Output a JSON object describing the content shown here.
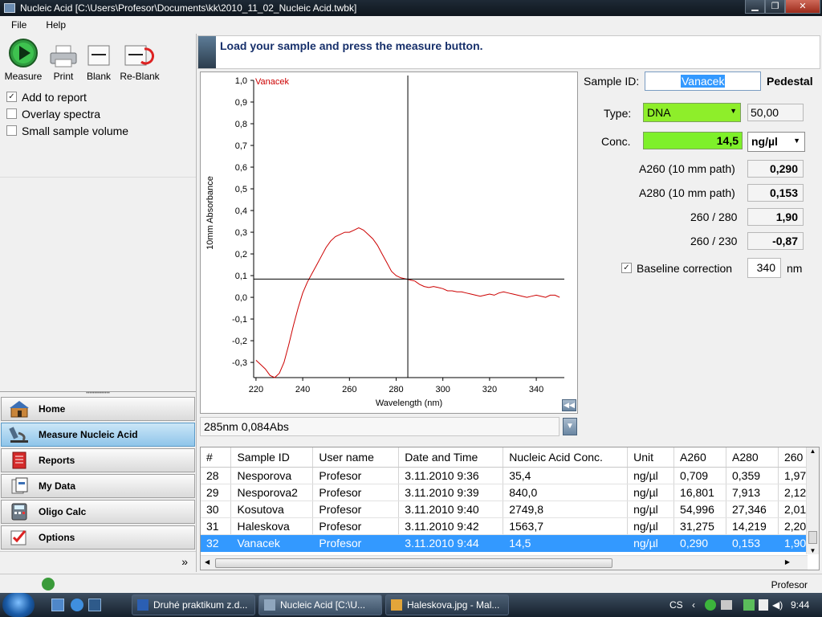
{
  "window": {
    "title": "Nucleic Acid  [C:\\Users\\Profesor\\Documents\\kk\\2010_11_02_Nucleic Acid.twbk]"
  },
  "menu": [
    "File",
    "Help"
  ],
  "toolbar": {
    "measure": "Measure",
    "print": "Print",
    "blank": "Blank",
    "reblank": "Re-Blank"
  },
  "options": {
    "add_to_report": {
      "label": "Add to report",
      "checked": true
    },
    "overlay_spectra": {
      "label": "Overlay spectra",
      "checked": false
    },
    "small_sample": {
      "label": "Small sample volume",
      "checked": false
    }
  },
  "nav": [
    {
      "label": "Home",
      "icon": "home-icon",
      "active": false
    },
    {
      "label": "Measure Nucleic Acid",
      "icon": "microscope-icon",
      "active": true
    },
    {
      "label": "Reports",
      "icon": "reports-icon",
      "active": false
    },
    {
      "label": "My Data",
      "icon": "my-data-icon",
      "active": false
    },
    {
      "label": "Oligo Calc",
      "icon": "calculator-icon",
      "active": false
    },
    {
      "label": "Options",
      "icon": "options-icon",
      "active": false
    }
  ],
  "message": "Load your sample and press the measure button.",
  "chart_data": {
    "type": "line",
    "series": [
      {
        "name": "Vanacek",
        "color": "#cc0000",
        "x": [
          220,
          222,
          224,
          226,
          228,
          230,
          232,
          234,
          236,
          238,
          240,
          242,
          244,
          246,
          248,
          250,
          252,
          254,
          256,
          258,
          260,
          262,
          264,
          266,
          268,
          270,
          272,
          274,
          276,
          278,
          280,
          282,
          284,
          286,
          288,
          290,
          292,
          294,
          296,
          298,
          300,
          302,
          304,
          306,
          308,
          310,
          312,
          314,
          316,
          318,
          320,
          322,
          324,
          326,
          328,
          330,
          332,
          334,
          336,
          338,
          340,
          342,
          344,
          346,
          348,
          350
        ],
        "y": [
          -0.29,
          -0.31,
          -0.33,
          -0.36,
          -0.37,
          -0.35,
          -0.3,
          -0.22,
          -0.13,
          -0.05,
          0.02,
          0.07,
          0.11,
          0.15,
          0.19,
          0.23,
          0.26,
          0.28,
          0.29,
          0.3,
          0.3,
          0.31,
          0.32,
          0.31,
          0.29,
          0.27,
          0.24,
          0.2,
          0.16,
          0.12,
          0.1,
          0.09,
          0.085,
          0.08,
          0.075,
          0.06,
          0.05,
          0.045,
          0.05,
          0.045,
          0.04,
          0.03,
          0.03,
          0.025,
          0.025,
          0.02,
          0.015,
          0.01,
          0.005,
          0.01,
          0.015,
          0.01,
          0.02,
          0.025,
          0.02,
          0.015,
          0.01,
          0.005,
          0.0,
          0.005,
          0.01,
          0.005,
          0.0,
          0.01,
          0.01,
          0.0
        ]
      }
    ],
    "xlabel": "Wavelength (nm)",
    "ylabel": "10mm Absorbance",
    "xlim": [
      219,
      352
    ],
    "ylim": [
      -0.37,
      1.0
    ],
    "xticks": [
      "220",
      "240",
      "260",
      "280",
      "300",
      "320",
      "340"
    ],
    "xtick_values": [
      220,
      240,
      260,
      280,
      300,
      320,
      340
    ],
    "yticks": [
      "1,0",
      "0,9",
      "0,8",
      "0,7",
      "0,6",
      "0,5",
      "0,4",
      "0,3",
      "0,2",
      "0,1",
      "0,0",
      "-0,1",
      "-0,2",
      "-0,3"
    ],
    "ytick_values": [
      1.0,
      0.9,
      0.8,
      0.7,
      0.6,
      0.5,
      0.4,
      0.3,
      0.2,
      0.1,
      0.0,
      -0.1,
      -0.2,
      -0.3
    ],
    "crosshair": {
      "x": 285,
      "y": 0.084
    },
    "grid": false,
    "legend": "top-left"
  },
  "readout": "285nm 0,084Abs",
  "sample": {
    "id_label": "Sample ID:",
    "id_value": "Vanacek",
    "mode": "Pedestal",
    "type_label": "Type:",
    "type_value": "DNA",
    "type_factor": "50,00",
    "conc_label": "Conc.",
    "conc_value": "14,5",
    "conc_unit": "ng/µl",
    "a260_label": "A260 (10 mm path)",
    "a260_value": "0,290",
    "a280_label": "A280 (10 mm path)",
    "a280_value": "0,153",
    "r260_280_label": "260 / 280",
    "r260_280_value": "1,90",
    "r260_230_label": "260 / 230",
    "r260_230_value": "-0,87",
    "baseline_label": "Baseline correction",
    "baseline_checked": true,
    "baseline_value": "340",
    "baseline_unit": "nm"
  },
  "table": {
    "columns": [
      "#",
      "Sample ID",
      "User name",
      "Date and Time",
      "Nucleic Acid Conc.",
      "Unit",
      "A260",
      "A280",
      "260"
    ],
    "rows": [
      [
        "28",
        "Nesporova",
        "Profesor",
        "3.11.2010 9:36",
        "35,4",
        "ng/µl",
        "0,709",
        "0,359",
        "1,97"
      ],
      [
        "29",
        "Nesporova2",
        "Profesor",
        "3.11.2010 9:39",
        "840,0",
        "ng/µl",
        "16,801",
        "7,913",
        "2,12"
      ],
      [
        "30",
        "Kosutova",
        "Profesor",
        "3.11.2010 9:40",
        "2749,8",
        "ng/µl",
        "54,996",
        "27,346",
        "2,01"
      ],
      [
        "31",
        "Haleskova",
        "Profesor",
        "3.11.2010 9:42",
        "1563,7",
        "ng/µl",
        "31,275",
        "14,219",
        "2,20"
      ],
      [
        "32",
        "Vanacek",
        "Profesor",
        "3.11.2010 9:44",
        "14,5",
        "ng/µl",
        "0,290",
        "0,153",
        "1,90"
      ]
    ],
    "selected_index": 4
  },
  "status": {
    "user": "Profesor"
  },
  "taskbar": {
    "tasks": [
      "Druhé praktikum z.d...",
      "Nucleic Acid  [C:\\U...",
      "Haleskova.jpg - Mal..."
    ],
    "language": "CS",
    "clock": "9:44"
  }
}
